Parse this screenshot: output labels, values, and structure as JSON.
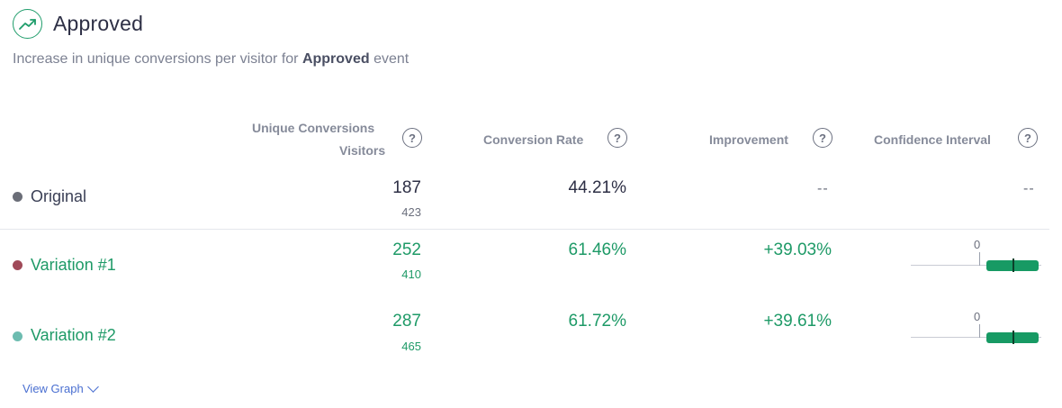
{
  "header": {
    "title": "Approved",
    "subtitle_prefix": "Increase in unique conversions per visitor for",
    "subtitle_event": "Approved",
    "subtitle_suffix": "event",
    "icon": "trend-up-icon"
  },
  "columns": {
    "conversions": "Unique Conversions",
    "visitors": "Visitors",
    "rate": "Conversion Rate",
    "improvement": "Improvement",
    "confidence": "Confidence Interval",
    "help_glyph": "?"
  },
  "rows": [
    {
      "name": "Original",
      "conversions": "187",
      "visitors": "423",
      "rate": "44.21%",
      "improvement": "--",
      "confidence": "--",
      "dot_color": "#6b6e78",
      "text_color": "#3a3f55"
    },
    {
      "name": "Variation #1",
      "conversions": "252",
      "visitors": "410",
      "rate": "61.46%",
      "improvement": "+39.03%",
      "ci_zero": "0",
      "dot_color": "#a04a59",
      "text_color": "#1e9a67"
    },
    {
      "name": "Variation #2",
      "conversions": "287",
      "visitors": "465",
      "rate": "61.72%",
      "improvement": "+39.61%",
      "ci_zero": "0",
      "dot_color": "#6dbcb0",
      "text_color": "#1e9a67"
    }
  ],
  "footer": {
    "view_graph": "View Graph"
  },
  "colors": {
    "positive": "#1e9a67",
    "ci_bar": "#179a64",
    "link": "#4a6fd1"
  }
}
